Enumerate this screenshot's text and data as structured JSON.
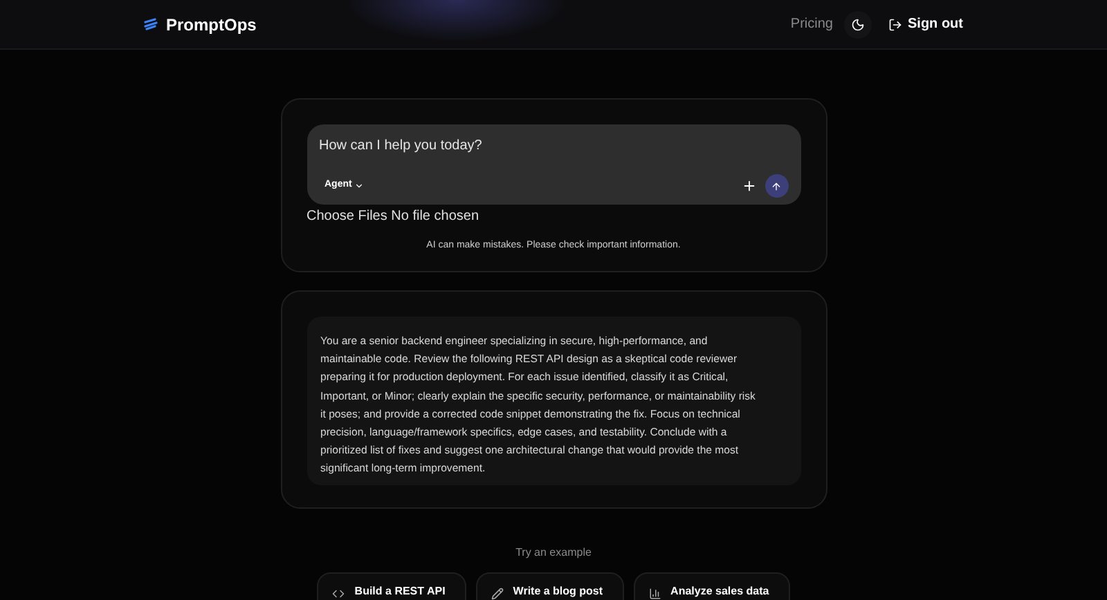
{
  "header": {
    "brand": "PromptOps",
    "nav": [
      {
        "label": "Pricing"
      }
    ],
    "sign_out": "Sign out"
  },
  "composer": {
    "placeholder": "How can I help you today?",
    "mode": "Agent",
    "file_button": "Choose Files",
    "file_status": "No file chosen",
    "disclaimer": "AI can make mistakes. Please check important information."
  },
  "prompt": {
    "text": "You are a senior backend engineer specializing in secure, high-performance, and maintainable code. Review the following REST API design as a skeptical code reviewer preparing it for production deployment. For each issue identified, classify it as Critical, Important, or Minor; clearly explain the specific security, performance, or maintainability risk it poses; and provide a corrected code snippet demonstrating the fix. Focus on technical precision, language/framework specifics, edge cases, and testability. Conclude with a prioritized list of fixes and suggest one architectural change that would provide the most significant long-term improvement."
  },
  "examples": {
    "title": "Try an example",
    "items": [
      {
        "kind": "code",
        "label": "Build a REST API"
      },
      {
        "kind": "pencil",
        "label": "Write a blog post"
      },
      {
        "kind": "chart",
        "label": "Analyze sales data"
      }
    ]
  }
}
